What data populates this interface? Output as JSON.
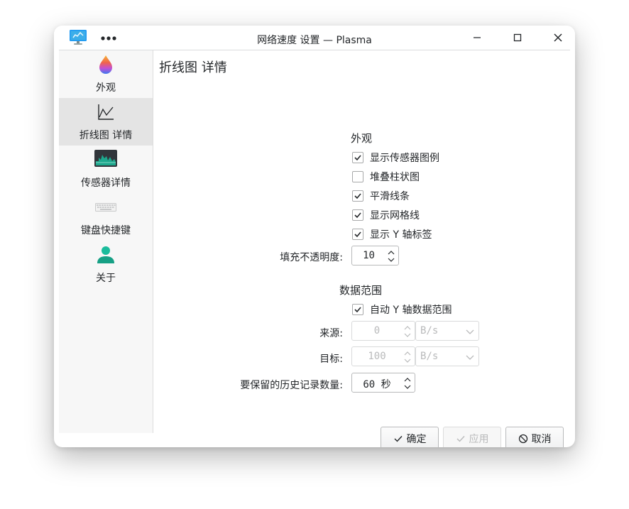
{
  "window": {
    "title": "网络速度 设置 — Plasma",
    "more_icon": "⋯"
  },
  "sidebar": {
    "items": [
      {
        "label": "外观",
        "icon": "appearance-drop-icon",
        "active": false
      },
      {
        "label": "折线图 详情",
        "icon": "line-chart-icon",
        "active": true
      },
      {
        "label": "传感器详情",
        "icon": "system-monitor-icon",
        "active": false
      },
      {
        "label": "键盘快捷键",
        "icon": "keyboard-icon",
        "active": false
      },
      {
        "label": "关于",
        "icon": "user-icon",
        "active": false
      }
    ]
  },
  "page": {
    "title": "折线图 详情"
  },
  "appearance": {
    "heading": "外观",
    "show_legend": {
      "label": "显示传感器图例",
      "checked": true
    },
    "stack_bars": {
      "label": "堆叠柱状图",
      "checked": false
    },
    "smooth_lines": {
      "label": "平滑线条",
      "checked": true
    },
    "show_grid": {
      "label": "显示网格线",
      "checked": true
    },
    "show_y_labels": {
      "label": "显示 Y 轴标签",
      "checked": true
    },
    "fill_opacity_label": "填充不透明度:",
    "fill_opacity_value": "10"
  },
  "data_range": {
    "heading": "数据范围",
    "auto_y_range": {
      "label": "自动 Y 轴数据范围",
      "checked": true
    },
    "from_label": "来源:",
    "from_value": "0",
    "from_unit": "B/s",
    "to_label": "目标:",
    "to_value": "100",
    "to_unit": "B/s",
    "history_label": "要保留的历史记录数量:",
    "history_value": "60 秒"
  },
  "buttons": {
    "ok": "确定",
    "apply": "应用",
    "cancel": "取消"
  },
  "colors": {
    "accent": "#3daee9",
    "text": "#232629",
    "disabled_text": "#b9babb"
  }
}
